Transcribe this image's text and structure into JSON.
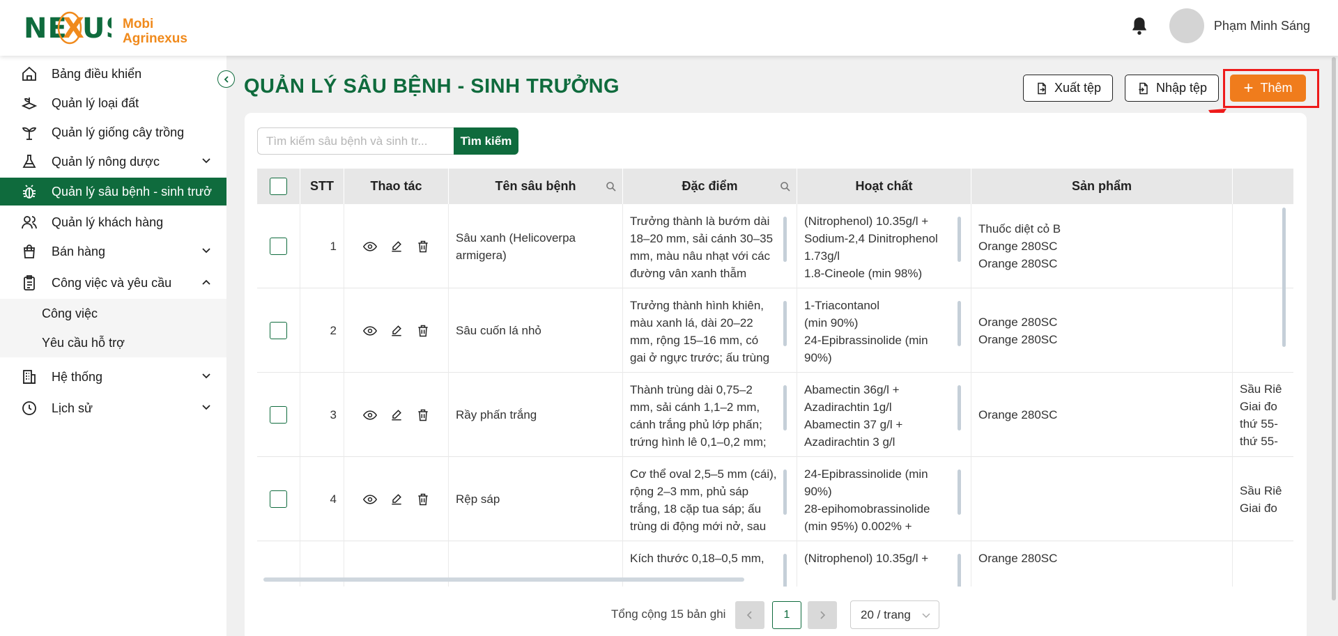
{
  "brand": {
    "logo_mark": "NEXUS",
    "name_line1": "Mobi",
    "name_line2": "Agrinexus"
  },
  "user": {
    "name": "Phạm Minh Sáng"
  },
  "sidebar": {
    "items": [
      {
        "label": "Bảng điều khiển",
        "icon": "home-icon"
      },
      {
        "label": "Quản lý loại đất",
        "icon": "soil-icon"
      },
      {
        "label": "Quản lý giống cây trồng",
        "icon": "plant-icon"
      },
      {
        "label": "Quản lý nông dược",
        "icon": "flask-icon"
      },
      {
        "label": "Quản lý sâu bệnh - sinh trưởng",
        "icon": "bug-icon"
      },
      {
        "label": "Quản lý khách hàng",
        "icon": "users-icon"
      },
      {
        "label": "Bán hàng",
        "icon": "bag-icon"
      },
      {
        "label": "Công việc và yêu cầu",
        "icon": "clipboard-icon"
      },
      {
        "label": "Hệ thống",
        "icon": "building-icon"
      },
      {
        "label": "Lịch sử",
        "icon": "clock-icon"
      }
    ],
    "sub_items": [
      {
        "label": "Công việc"
      },
      {
        "label": "Yêu cầu hỗ trợ"
      }
    ]
  },
  "page": {
    "title": "QUẢN LÝ SÂU BỆNH - SINH TRƯỞNG"
  },
  "toolbar": {
    "export_label": "Xuất tệp",
    "import_label": "Nhập tệp",
    "add_label": "Thêm",
    "add_plus": "+"
  },
  "search": {
    "placeholder": "Tìm kiếm sâu bệnh và sinh tr...",
    "button_label": "Tìm kiếm"
  },
  "table": {
    "columns": [
      "STT",
      "Thao tác",
      "Tên sâu bệnh",
      "Đặc điểm",
      "Hoạt chất",
      "Sản phẩm"
    ],
    "rows": [
      {
        "stt": "1",
        "name": "Sâu xanh (Helicoverpa armigera)",
        "features": "Trưởng thành là bướm dài 18–20 mm, sải cánh 30–35 mm, màu nâu nhạt với các đường vân xanh thẫm",
        "ingredients": "(Nitrophenol) 10.35g/l + Sodium-2,4 Dinitrophenol 1.73g/l\n1.8-Cineole (min 98%)",
        "products": "Thuốc diệt cỏ B\nOrange 280SC\nOrange 280SC",
        "extra": ""
      },
      {
        "stt": "2",
        "name": "Sâu cuốn lá nhỏ",
        "features": "Trưởng thành hình khiên, màu xanh lá, dài 20–22 mm, rộng 15–16 mm, có gai ở ngực trước; ấu trùng",
        "ingredients": "1-Triacontanol\n(min 90%)\n24-Epibrassinolide (min 90%)",
        "products": "Orange 280SC\nOrange 280SC",
        "extra": ""
      },
      {
        "stt": "3",
        "name": "Rầy phấn trắng",
        "features": "Thành trùng dài 0,75–2 mm, sải cánh 1,1–2 mm, cánh trắng phủ lớp phấn; trứng hình lê 0,1–0,2 mm;",
        "ingredients": "Abamectin 36g/l + Azadirachtin 1g/l\nAbamectin 37 g/l + Azadirachtin 3 g/l",
        "products": "Orange 280SC",
        "extra": "Sầu Riê\nGiai đo\nthứ 55-\nthứ 55-"
      },
      {
        "stt": "4",
        "name": "Rệp sáp",
        "features": "Cơ thể oval 2,5–5 mm (cái), rộng 2–3 mm, phủ sáp trắng, 18 cặp tua sáp; ấu trùng di động mới nở, sau",
        "ingredients": "24-Epibrassinolide (min 90%)\n28-epihomobrassinolide (min 95%) 0.002% +",
        "products": "",
        "extra": "Sầu Riê\nGiai đo"
      },
      {
        "stt": "",
        "name": "",
        "features": "Kích thước 0,18–0,5 mm,",
        "ingredients": "(Nitrophenol) 10.35g/l +",
        "products": "Orange 280SC",
        "extra": ""
      }
    ]
  },
  "pagination": {
    "total_label": "Tổng cộng 15 bản ghi",
    "current_page": "1",
    "page_size_label": "20 / trang"
  }
}
